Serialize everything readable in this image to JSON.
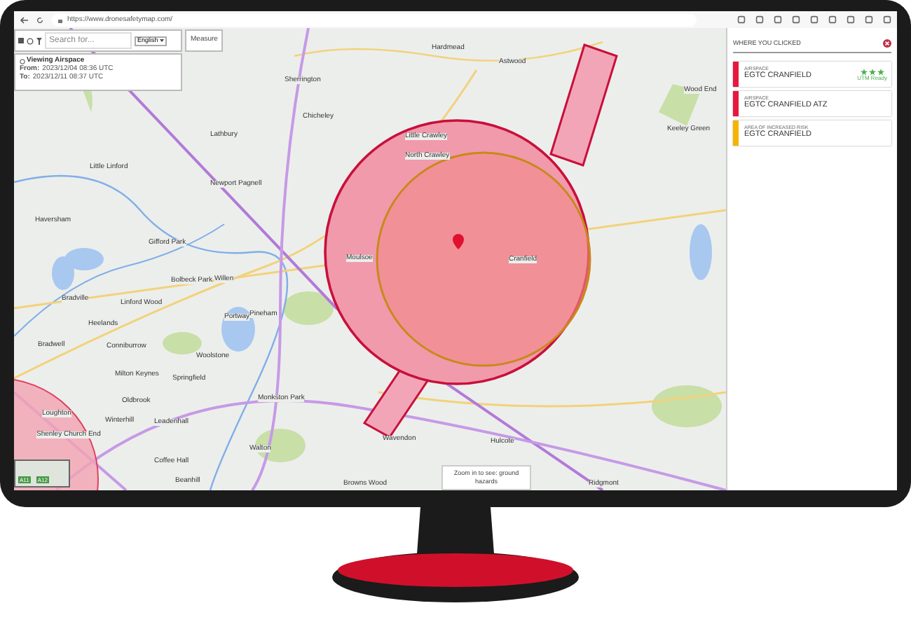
{
  "browser": {
    "url": "https://www.dronesafetymap.com/"
  },
  "toolbar": {
    "search_placeholder": "Search for...",
    "language": "English",
    "measure_button": "Measure"
  },
  "viewing": {
    "title": "Viewing Airspace",
    "from_label": "From:",
    "from": "2023/12/04 08:36 UTC",
    "to_label": "To:",
    "to": "2023/12/11 08:37 UTC"
  },
  "map": {
    "places": [
      "Hardmead",
      "Astwood",
      "Sherrington",
      "Wood End",
      "Chicheley",
      "Little Crawley",
      "Keeley Green",
      "Lathbury",
      "North Crawley",
      "Little Linford",
      "Newport Pagnell",
      "Haversham",
      "Gifford Park",
      "Cranfield",
      "Moulsoe",
      "Willen",
      "Bolbeck Park",
      "Bradville",
      "Linford Wood",
      "Portway",
      "Pineham",
      "Heelands",
      "Bradwell",
      "Conniburrow",
      "Woolstone",
      "Milton Keynes",
      "Springfield",
      "Oldbrook",
      "Monkston Park",
      "Loughton",
      "Winterhill",
      "Leadenhall",
      "Hulcote",
      "Wavendon",
      "Shenley Church End",
      "Coffee Hall",
      "Walton",
      "Browns Wood",
      "Ridgmont",
      "Beanhill"
    ],
    "layer_thumbnails": [
      "A11",
      "A12"
    ],
    "hint": "Zoom in to see: ground hazards"
  },
  "panel": {
    "title": "WHERE YOU CLICKED",
    "results": [
      {
        "category": "AIRSPACE",
        "name": "EGTC CRANFIELD",
        "color": "#e8173f",
        "stars": 3,
        "badge": "UTM Ready"
      },
      {
        "category": "AIRSPACE",
        "name": "EGTC CRANFIELD ATZ",
        "color": "#e8173f"
      },
      {
        "category": "AREA OF INCREASED RISK",
        "name": "EGTC CRANFIELD",
        "color": "#f5b400"
      }
    ]
  }
}
